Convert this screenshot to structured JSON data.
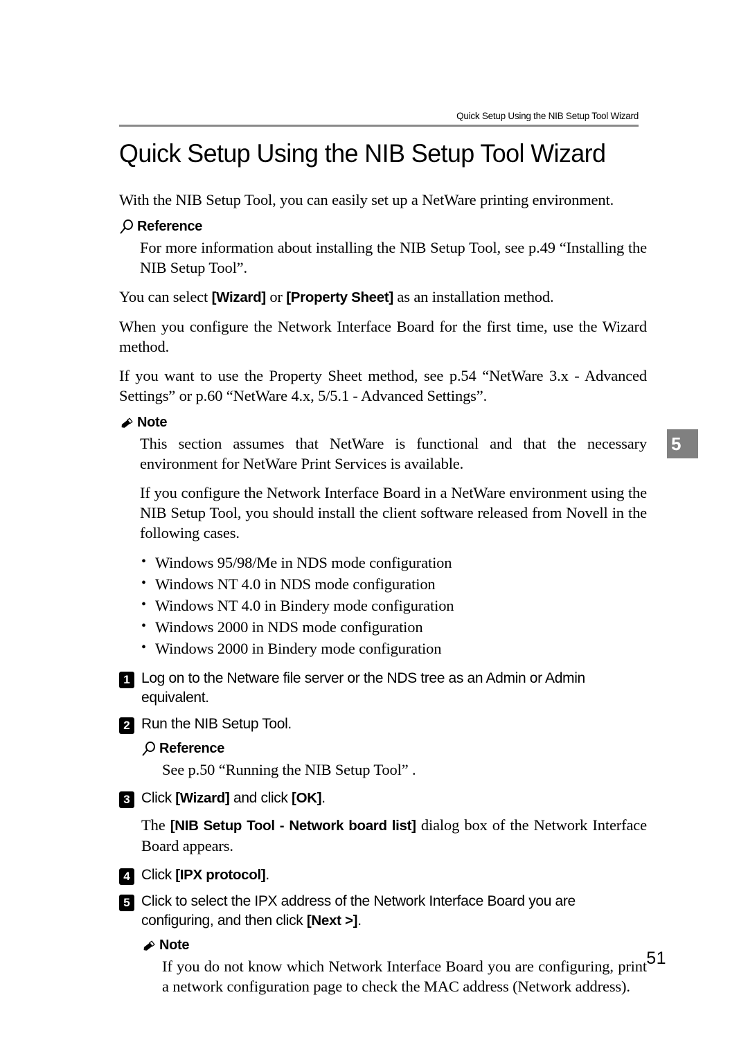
{
  "header": {
    "running_title": "Quick Setup Using the NIB Setup Tool Wizard"
  },
  "chapter_tab": {
    "number": "5"
  },
  "title": "Quick Setup Using the NIB Setup Tool Wizard",
  "intro": "With the NIB Setup Tool, you can easily set up a NetWare printing environment.",
  "reference_1": {
    "icon": "magnifier-icon",
    "label": "Reference",
    "text": "For more information about installing the NIB Setup Tool, see p.49 “Installing the NIB Setup Tool”."
  },
  "para_select": {
    "prefix": "You can select ",
    "token_1": "[Wizard]",
    "middle": " or ",
    "token_2": "[Property Sheet]",
    "suffix": " as an installation method."
  },
  "para_first_time": "When you configure the Network Interface Board for the first time, use the Wizard method.",
  "para_property_sheet": "If you want to use the Property Sheet method, see p.54 “NetWare 3.x - Advanced Settings” or p.60 “NetWare 4.x, 5/5.1 - Advanced Settings”.",
  "note_1": {
    "icon": "pencil-icon",
    "label": "Note",
    "text_1": "This section assumes that NetWare is functional and that the necessary environment for NetWare Print Services is available.",
    "text_2": "If you configure the Network Interface Board in a NetWare environment using the NIB Setup Tool, you should install the client software released from Novell in the following cases.",
    "bullets": [
      "Windows 95/98/Me in NDS mode configuration",
      "Windows NT 4.0 in NDS mode configuration",
      "Windows NT 4.0 in Bindery mode configuration",
      "Windows 2000 in NDS mode configuration",
      "Windows 2000 in Bindery mode configuration"
    ]
  },
  "steps": {
    "step_1": {
      "number": "1",
      "text": "Log on to the Netware file server or the NDS tree as an Admin or Admin equivalent."
    },
    "step_2": {
      "number": "2",
      "text": "Run the NIB Setup Tool.",
      "reference": {
        "icon": "magnifier-icon",
        "label": "Reference",
        "text": "See p.50 “Running the NIB Setup Tool” ."
      }
    },
    "step_3": {
      "number": "3",
      "prefix": "Click  ",
      "token_1": "[Wizard]",
      "middle": " and click  ",
      "token_2": "[OK]",
      "suffix": ".",
      "result_prefix": "The ",
      "result_token": "[NIB Setup Tool - Network board list]",
      "result_suffix": " dialog box of the Network Interface Board appears."
    },
    "step_4": {
      "number": "4",
      "prefix": "Click  ",
      "token_1": "[IPX protocol]",
      "suffix": "."
    },
    "step_5": {
      "number": "5",
      "prefix": "Click to select the IPX address of the Network Interface Board you are configuring, and then click   ",
      "token_1": "[Next >]",
      "suffix": "."
    }
  },
  "note_2": {
    "icon": "pencil-icon",
    "label": "Note",
    "text": "If you do not know which Network Interface Board you are configuring, print a network configuration page to check the MAC address (Network address)."
  },
  "page_number": "51",
  "colors": {
    "rule": "#8a8a8a",
    "chapter_tab_bg": "#808080",
    "text": "#000000"
  }
}
